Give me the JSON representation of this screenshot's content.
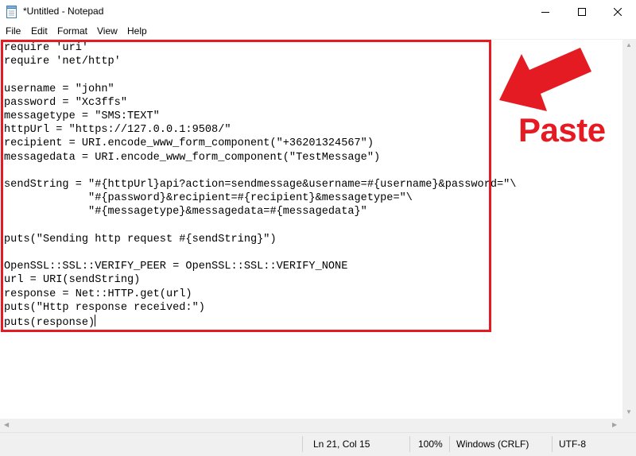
{
  "window": {
    "title": "*Untitled - Notepad",
    "minimize_icon": "minimize-icon",
    "maximize_icon": "maximize-icon",
    "close_icon": "close-icon",
    "app_icon": "notepad-icon"
  },
  "menu": {
    "items": [
      {
        "label": "File"
      },
      {
        "label": "Edit"
      },
      {
        "label": "Format"
      },
      {
        "label": "View"
      },
      {
        "label": "Help"
      }
    ]
  },
  "editor": {
    "content": "require 'uri'\nrequire 'net/http'\n\nusername = \"john\"\npassword = \"Xc3ffs\"\nmessagetype = \"SMS:TEXT\"\nhttpUrl = \"https://127.0.0.1:9508/\"\nrecipient = URI.encode_www_form_component(\"+36201324567\")\nmessagedata = URI.encode_www_form_component(\"TestMessage\")\n\nsendString = \"#{httpUrl}api?action=sendmessage&username=#{username}&password=\"\\\n             \"#{password}&recipient=#{recipient}&messagetype=\"\\\n             \"#{messagetype}&messagedata=#{messagedata}\"\n\nputs(\"Sending http request #{sendString}\")\n\nOpenSSL::SSL::VERIFY_PEER = OpenSSL::SSL::VERIFY_NONE\nurl = URI(sendString)\nresponse = Net::HTTP.get(url)\nputs(\"Http response received:\")\nputs(response)"
  },
  "annotation": {
    "label": "Paste",
    "color": "#e41b23",
    "arrow_icon": "arrow-pointing-left-down-icon"
  },
  "statusbar": {
    "position": "Ln 21, Col 15",
    "zoom": "100%",
    "line_ending": "Windows (CRLF)",
    "encoding": "UTF-8"
  }
}
